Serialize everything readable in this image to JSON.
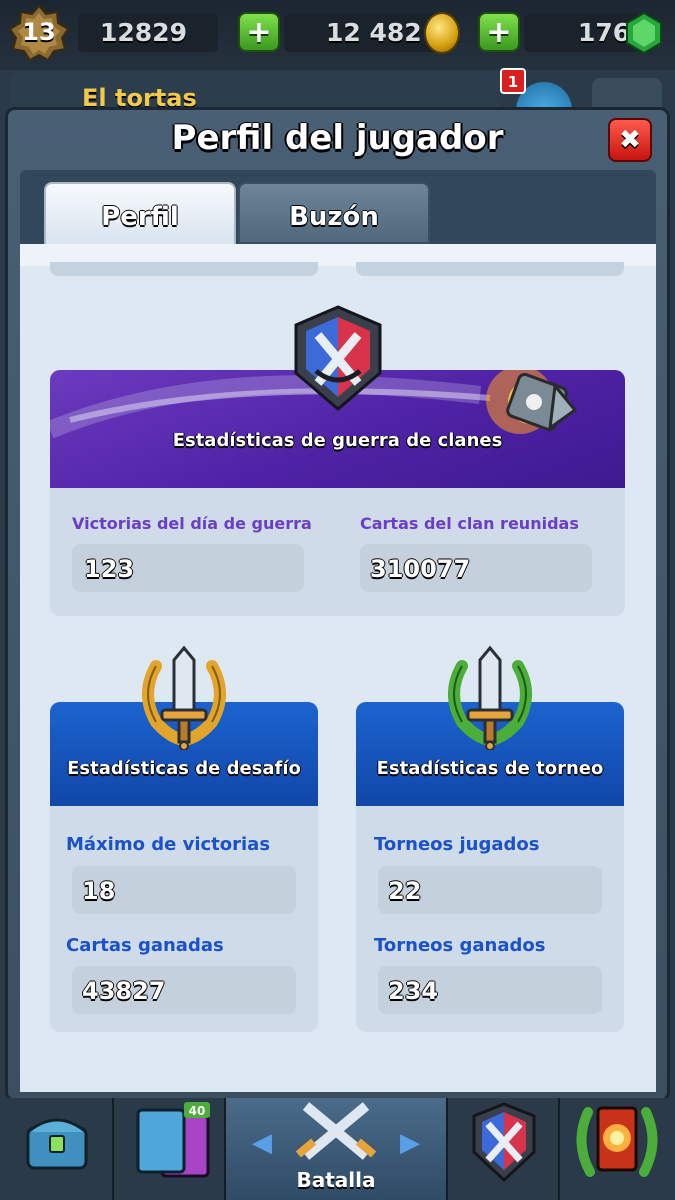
{
  "topbar": {
    "level": "13",
    "trophies_value": "12829",
    "gold_value": "12 482",
    "gems_value": "176",
    "plus_label": "+"
  },
  "background": {
    "clan_name": "El tortas",
    "notification_count": "1"
  },
  "modal": {
    "title": "Perfil del jugador",
    "close_label": "✖",
    "tabs": [
      {
        "label": "Perfil",
        "active": true
      },
      {
        "label": "Buzón",
        "active": false
      }
    ]
  },
  "clan_war": {
    "title": "Estadísticas de guerra de clanes",
    "fields": [
      {
        "label": "Victorias del día de guerra",
        "value": "123"
      },
      {
        "label": "Cartas del clan reunidas",
        "value": "310077"
      }
    ]
  },
  "challenge": {
    "title": "Estadísticas de desafío",
    "fields": [
      {
        "label": "Máximo de victorias",
        "value": "18"
      },
      {
        "label": "Cartas ganadas",
        "value": "43827"
      }
    ]
  },
  "tournament": {
    "title": "Estadísticas de torneo",
    "fields": [
      {
        "label": "Torneos jugados",
        "value": "22"
      },
      {
        "label": "Torneos ganados",
        "value": "234"
      }
    ]
  },
  "bottom_nav": {
    "center_label": "Batalla",
    "cards_badge": "40",
    "icons": [
      "chest-icon",
      "cards-icon",
      "battle-swords-icon",
      "clan-war-icon",
      "tournament-icon"
    ]
  },
  "colors": {
    "war_banner": "#4f22a5",
    "stat_banner": "#1047a8",
    "war_label": "#6a3fc6",
    "blue_label": "#1a52c8"
  }
}
